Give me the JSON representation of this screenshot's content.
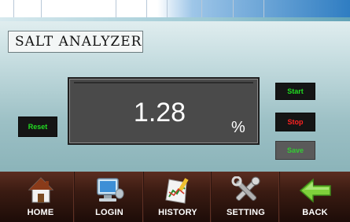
{
  "title": "SALT ANALYZER",
  "display": {
    "value": "1.28",
    "unit": "%"
  },
  "buttons": {
    "reset": "Reset",
    "start": "Start",
    "stop": "Stop",
    "save": "Save"
  },
  "nav": [
    {
      "label": "HOME",
      "icon": "house-icon"
    },
    {
      "label": "LOGIN",
      "icon": "computer-icon"
    },
    {
      "label": "HISTORY",
      "icon": "chart-icon"
    },
    {
      "label": "SETTING",
      "icon": "tools-icon"
    },
    {
      "label": "BACK",
      "icon": "arrow-left-icon"
    }
  ],
  "colors": {
    "start_text": "#22dd22",
    "stop_text": "#ff2222",
    "save_text": "#33cc33",
    "nav_background": "#3a1b12"
  }
}
